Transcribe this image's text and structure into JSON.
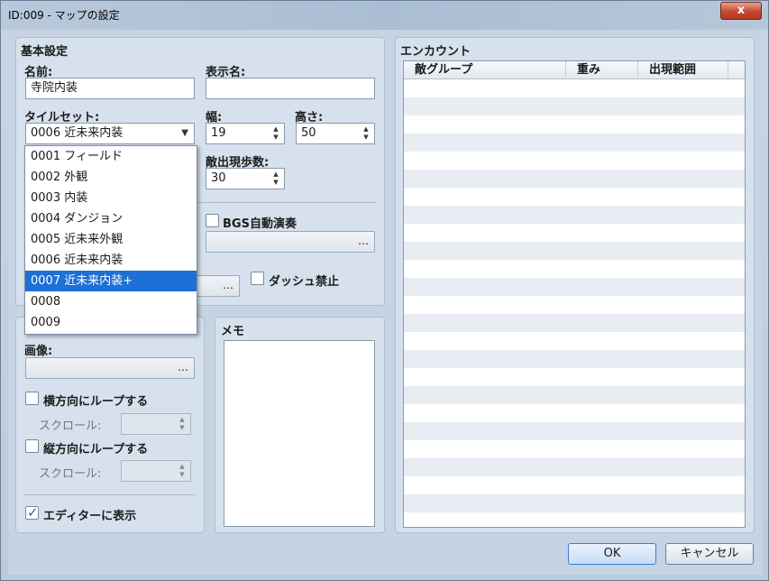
{
  "window": {
    "title": "ID:009 - マップの設定",
    "close_label": "x"
  },
  "basic": {
    "heading": "基本設定",
    "name_label": "名前:",
    "name_value": "寺院内装",
    "display_name_label": "表示名:",
    "display_name_value": "",
    "tileset_label": "タイルセット:",
    "tileset_value": "0006 近未来内装",
    "width_label": "幅:",
    "width_value": "19",
    "height_label": "高さ:",
    "height_value": "50",
    "encounter_steps_label": "敵出現歩数:",
    "encounter_steps_value": "30",
    "bgs_label": "BGS自動演奏",
    "dash_label": "ダッシュ禁止"
  },
  "tileset_options": [
    "0001 フィールド",
    "0002 外観",
    "0003 内装",
    "0004 ダンジョン",
    "0005 近未来外観",
    "0006 近未来内装",
    "0007 近未来内装+",
    "0008",
    "0009"
  ],
  "parallax": {
    "image_label": "画像:",
    "loop_h_label": "横方向にループする",
    "scroll_h_label": "スクロール:",
    "loop_v_label": "縦方向にループする",
    "scroll_v_label": "スクロール:",
    "show_editor_label": "エディターに表示"
  },
  "memo": {
    "heading": "メモ"
  },
  "encounter": {
    "heading": "エンカウント",
    "columns": [
      "敵グループ",
      "重み",
      "出現範囲"
    ]
  },
  "buttons": {
    "ok": "OK",
    "cancel": "キャンセル"
  },
  "icons": {
    "dots": "…"
  }
}
